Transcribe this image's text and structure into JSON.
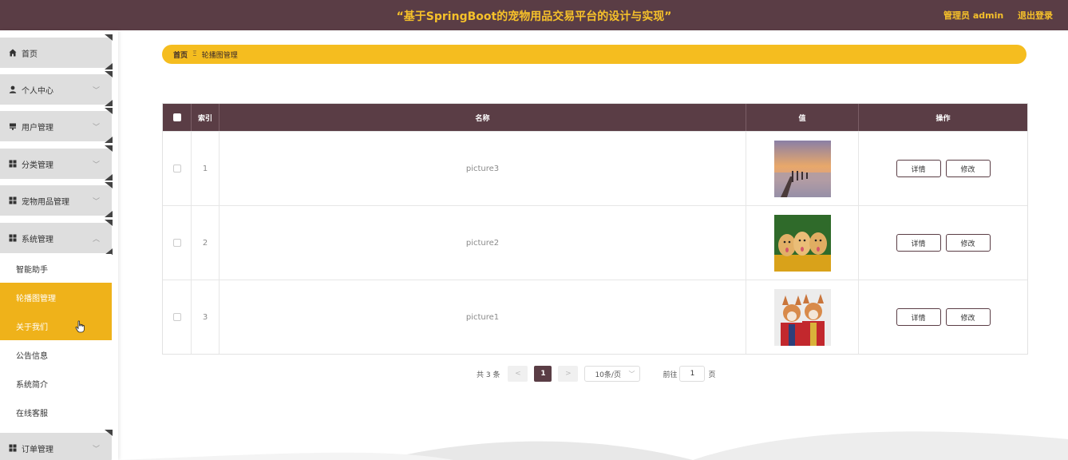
{
  "header": {
    "title": "“基于SpringBoot的宠物用品交易平台的设计与实现”",
    "user": "管理员 admin",
    "logout": "退出登录"
  },
  "sidebar": {
    "items": [
      {
        "label": "首页",
        "icon": "home-icon"
      },
      {
        "label": "个人中心",
        "icon": "person-icon"
      },
      {
        "label": "用户管理",
        "icon": "user-manage-icon"
      },
      {
        "label": "分类管理",
        "icon": "grid-icon"
      },
      {
        "label": "宠物用品管理",
        "icon": "grid-icon"
      },
      {
        "label": "系统管理",
        "icon": "grid-icon"
      },
      {
        "label": "订单管理",
        "icon": "grid-icon"
      }
    ],
    "subitems": [
      "智能助手",
      "轮播图管理",
      "关于我们",
      "公告信息",
      "系统简介",
      "在线客服"
    ]
  },
  "breadcrumb": {
    "home": "首页",
    "separator": "Ξ",
    "current": "轮播图管理"
  },
  "table": {
    "headers": {
      "index": "索引",
      "name": "名称",
      "value": "值",
      "actions": "操作"
    },
    "rows": [
      {
        "index": "1",
        "name": "picture3",
        "image": "sunset-pier-photo"
      },
      {
        "index": "2",
        "name": "picture2",
        "image": "golden-retriever-puppies-photo"
      },
      {
        "index": "3",
        "name": "picture1",
        "image": "corgi-dogs-photo"
      }
    ],
    "detail_label": "详情",
    "edit_label": "修改"
  },
  "pagination": {
    "total": "共 3 条",
    "prev": "<",
    "current_page": "1",
    "next": ">",
    "page_size": "10条/页",
    "goto_label": "前往",
    "goto_value": "1",
    "page_suffix": "页"
  },
  "colors": {
    "header_bg": "#5a3d45",
    "accent": "#f5bd1f",
    "active_sub": "#efb21a"
  }
}
